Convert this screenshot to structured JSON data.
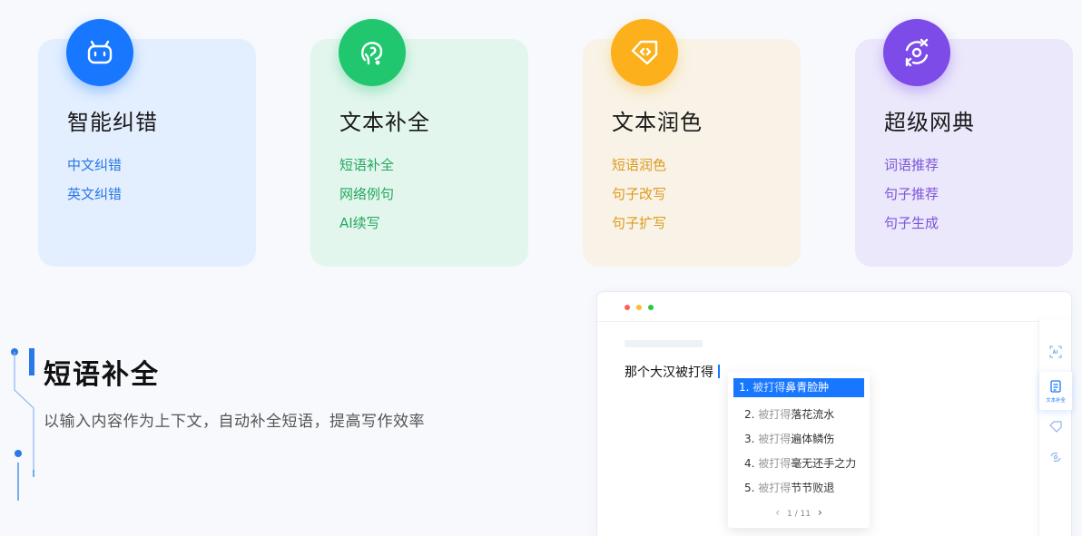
{
  "cards": [
    {
      "title": "智能纠错",
      "links": [
        "中文纠错",
        "英文纠错"
      ],
      "icon": "robot-face-icon"
    },
    {
      "title": "文本补全",
      "links": [
        "短语补全",
        "网络例句",
        "AI续写"
      ],
      "icon": "speech-head-icon"
    },
    {
      "title": "文本润色",
      "links": [
        "短语润色",
        "句子改写",
        "句子扩写"
      ],
      "icon": "diamond-tag-icon"
    },
    {
      "title": "超级网典",
      "links": [
        "词语推荐",
        "句子推荐",
        "句子生成"
      ],
      "icon": "transform-cycle-icon"
    }
  ],
  "feature": {
    "title": "短语补全",
    "description": "以输入内容作为上下文，自动补全短语，提高写作效率"
  },
  "demo": {
    "editor_text": "那个大汉被打得",
    "suggestion_prefix": "被打得",
    "suggestions": [
      {
        "num": "1.",
        "text": "鼻青脸肿"
      },
      {
        "num": "2.",
        "text": "落花流水"
      },
      {
        "num": "3.",
        "text": "遍体鳞伤"
      },
      {
        "num": "4.",
        "text": "毫无还手之力"
      },
      {
        "num": "5.",
        "text": "节节败退"
      }
    ],
    "pager": {
      "current": "1",
      "separator": "/",
      "total": "11"
    },
    "toolbar_active_label": "文本补全"
  },
  "colors": {
    "blue": "#1877ff",
    "green": "#21c76e",
    "orange": "#fbb01c",
    "purple": "#7d4be8",
    "dot_red": "#ff5f57",
    "dot_yellow": "#febc2e",
    "dot_green": "#28c840"
  }
}
